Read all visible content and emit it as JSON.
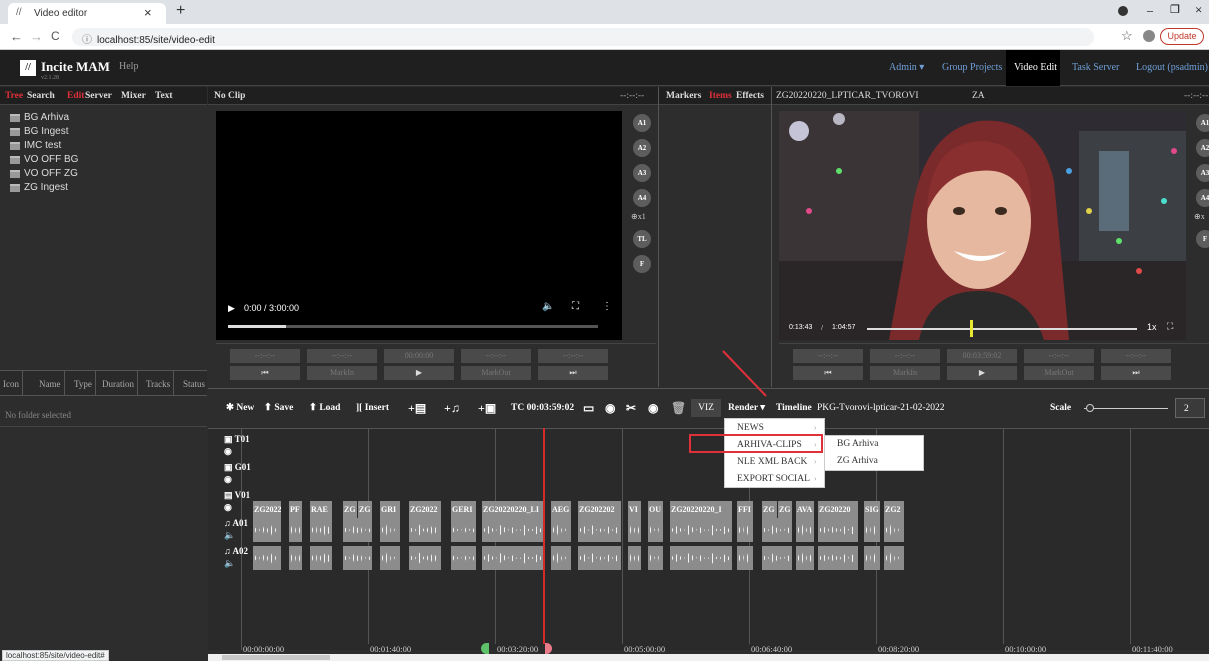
{
  "browser": {
    "tab_title": "Video editor",
    "tab_close": "×",
    "new_tab": "+",
    "url": "localhost:85/site/video-edit",
    "update_label": "Update",
    "status_url": "localhost:85/site/video-edit#"
  },
  "app": {
    "logo_text": "Incite MAM",
    "version": "v2.1.28",
    "help": "Help",
    "nav": [
      "Admin ▾",
      "Group Projects",
      "Video Edit",
      "Task Server",
      "Logout (psadmin)"
    ]
  },
  "left_panel": {
    "tabs": [
      "Tree",
      "Search",
      "Edit",
      "Server",
      "Mixer",
      "Text"
    ],
    "tree_items": [
      "BG Arhiva",
      "BG Ingest",
      "IMC test",
      "VO OFF BG",
      "VO OFF ZG",
      "ZG Ingest"
    ],
    "columns": [
      "Icon",
      "Name",
      "Type",
      "Duration",
      "Tracks",
      "Status"
    ],
    "empty_text": "No folder selected"
  },
  "source_panel": {
    "title": "No Clip",
    "timecode": "--:--:--",
    "time_display": "0:00 / 3:00:00",
    "side_buttons": [
      "A1",
      "A2",
      "A3",
      "A4",
      "TL",
      "F"
    ],
    "zoom": "x1",
    "tc_boxes": [
      "--:--:--",
      "--:--:--",
      "00:00:00",
      "--:--:--",
      "--:--:--"
    ],
    "controls": [
      "⏮",
      "MarkIn",
      "▶",
      "MarkOut",
      "⏭"
    ]
  },
  "middle_panel": {
    "tabs": [
      "Markers",
      "Items",
      "Effects"
    ]
  },
  "program_panel": {
    "title": "ZG20220220_LPTICAR_TVOROVI",
    "title_suffix": "ZA",
    "timecode": "--:--:--",
    "time_current": "0:13:43",
    "time_total": "1:04:57",
    "speed": "1x",
    "progress": 0.38,
    "side_buttons": [
      "A1",
      "A2",
      "A3",
      "A4",
      "F"
    ],
    "zoom": "x",
    "tc_boxes": [
      "--:--:--",
      "--:--:--",
      "00:03:59:02",
      "--:--:--",
      "--:--:--"
    ],
    "controls": [
      "⏮",
      "MarkIn",
      "▶",
      "MarkOut",
      "⏭"
    ]
  },
  "toolbar": {
    "new": "New",
    "save": "Save",
    "load": "Load",
    "insert": "Insert",
    "tc": "TC 00:03:59:02",
    "viz": "VIZ",
    "render": "Render ▾",
    "timeline_label": "Timeline",
    "timeline_name": "PKG-Tvorovi-lpticar-21-02-2022",
    "scale_label": "Scale",
    "scale_value": "2"
  },
  "render_menu": {
    "items": [
      "NEWS",
      "ARHIVA-CLIPS",
      "NLE XML BACK",
      "EXPORT SOCIAL"
    ],
    "submenu": [
      "BG Arhiva",
      "ZG Arhiva"
    ]
  },
  "tracks": {
    "labels": [
      "T01",
      "G01",
      "V01",
      "A01",
      "A02"
    ],
    "video_clips": [
      "ZG2022",
      "PF",
      "RAE",
      "ZG",
      "ZG",
      "GRI",
      "ZG2022",
      "GERI",
      "ZG20220220_LI",
      "AEG",
      "ZG202202",
      "VI",
      "OU",
      "ZG20220220_I",
      "FFI",
      "ZG",
      "ZG",
      "AVA",
      "ZG20220",
      "SIG",
      "ZG2"
    ],
    "ticks": [
      "00:00:00:00",
      "00:01:40:00",
      "00:03:20:00",
      "00:05:00:00",
      "00:06:40:00",
      "00:08:20:00",
      "00:10:00:00",
      "00:11:40:00"
    ]
  },
  "colors": {
    "accent_red": "#e0303a",
    "nav_blue": "#6fa0d8",
    "playhead": "#d42a2a"
  }
}
